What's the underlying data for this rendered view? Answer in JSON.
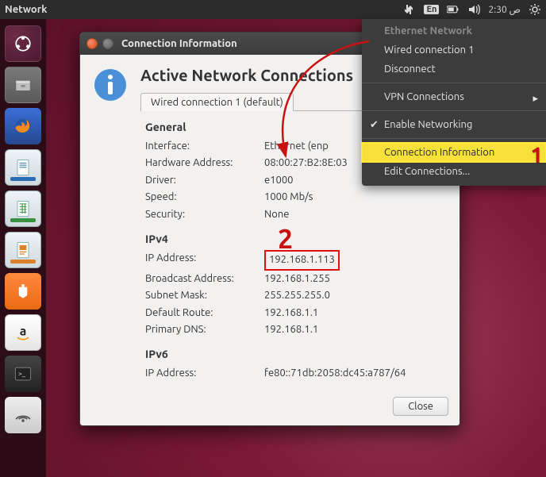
{
  "top_panel": {
    "title": "Network",
    "lang": "En",
    "time": "ص 2:30"
  },
  "dropdown": {
    "header": "Ethernet Network",
    "wired": "Wired connection 1",
    "disconnect": "Disconnect",
    "vpn": "VPN Connections",
    "enable_networking": "Enable Networking",
    "conn_info": "Connection Information",
    "edit_conn": "Edit Connections..."
  },
  "dialog": {
    "window_title": "Connection Information",
    "heading": "Active Network Connections",
    "tab": "Wired connection 1 (default)",
    "general_title": "General",
    "general": {
      "interface_k": "Interface:",
      "interface_v": "Ethernet (enp",
      "hwaddr_k": "Hardware Address:",
      "hwaddr_v": "08:00:27:B2:8E:03",
      "driver_k": "Driver:",
      "driver_v": "e1000",
      "speed_k": "Speed:",
      "speed_v": "1000 Mb/s",
      "security_k": "Security:",
      "security_v": "None"
    },
    "ipv4_title": "IPv4",
    "ipv4": {
      "ip_k": "IP Address:",
      "ip_v": "192.168.1.113",
      "bcast_k": "Broadcast Address:",
      "bcast_v": "192.168.1.255",
      "mask_k": "Subnet Mask:",
      "mask_v": "255.255.255.0",
      "route_k": "Default Route:",
      "route_v": "192.168.1.1",
      "dns_k": "Primary DNS:",
      "dns_v": "192.168.1.1"
    },
    "ipv6_title": "IPv6",
    "ipv6": {
      "ip_k": "IP Address:",
      "ip_v": "fe80::71db:2058:dc45:a787/64"
    },
    "close": "Close"
  },
  "annotations": {
    "one": "1",
    "two": "2"
  }
}
